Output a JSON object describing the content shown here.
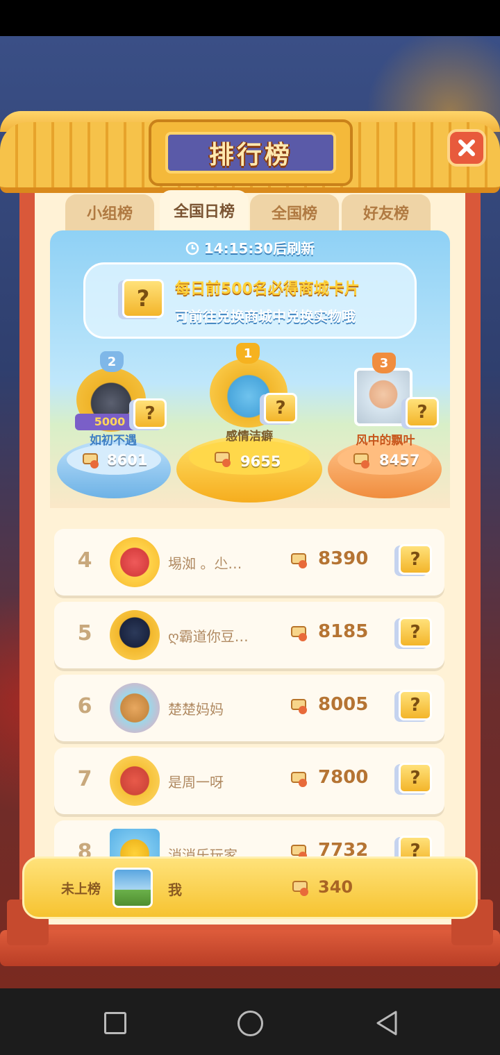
{
  "title": "排行榜",
  "tabs": [
    {
      "label": "小组榜",
      "active": false
    },
    {
      "label": "全国日榜",
      "active": true
    },
    {
      "label": "全国榜",
      "active": false
    },
    {
      "label": "好友榜",
      "active": false
    }
  ],
  "refresh_text": "14:15:30后刷新",
  "promo": {
    "line1": "每日前500名必得商城卡片",
    "line2": "可前往兑换商城中兑换实物哦"
  },
  "podium": [
    {
      "rank": "2",
      "name": "如初不遇",
      "score": "8601",
      "badge": "5000"
    },
    {
      "rank": "1",
      "name": "感情洁癖",
      "score": "9655"
    },
    {
      "rank": "3",
      "name": "风中的飘叶",
      "score": "8457"
    }
  ],
  "rows": [
    {
      "rank": "4",
      "name": "埸洳 。尐…",
      "score": "8390"
    },
    {
      "rank": "5",
      "name": "ღ霸道你豆…",
      "score": "8185"
    },
    {
      "rank": "6",
      "name": "楚楚妈妈",
      "score": "8005"
    },
    {
      "rank": "7",
      "name": "是周一呀",
      "score": "7800"
    },
    {
      "rank": "8",
      "name": "消消乐玩家",
      "score": "7732"
    }
  ],
  "me": {
    "status": "未上榜",
    "name": "我",
    "score": "340"
  },
  "card_symbol": "?",
  "colors": {
    "gold": "#f6c330",
    "frame_red": "#d9583a",
    "title_purple": "#5a5aa8"
  }
}
